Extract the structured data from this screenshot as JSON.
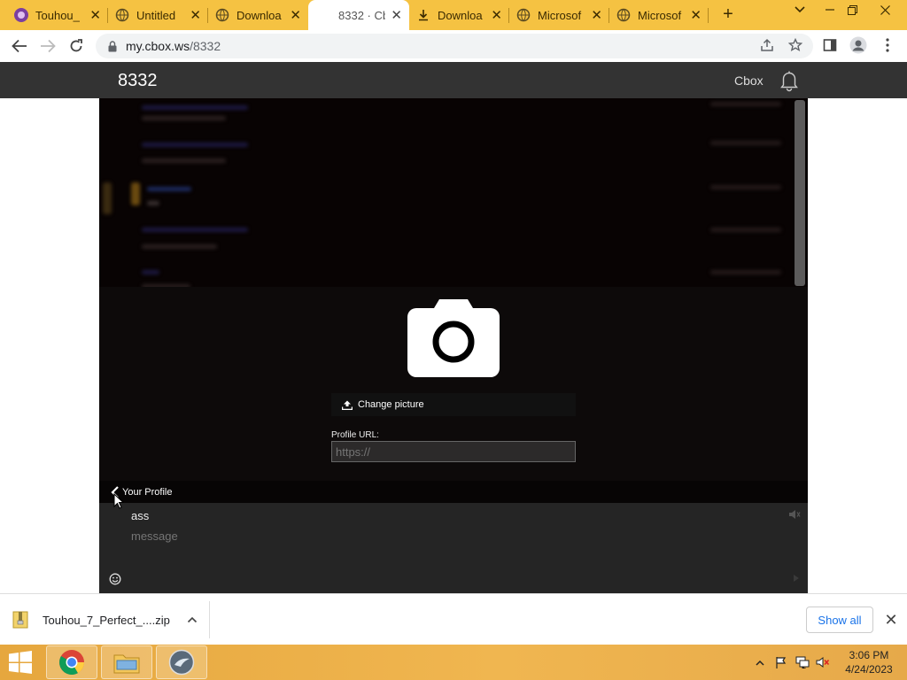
{
  "browser": {
    "tabs": [
      {
        "title": "Touhou_",
        "icon": "touhou-icon"
      },
      {
        "title": "Untitled",
        "icon": "globe-icon"
      },
      {
        "title": "Downloa",
        "icon": "globe-icon"
      },
      {
        "title": "8332 · Cb",
        "icon": "none"
      },
      {
        "title": "Downloa",
        "icon": "download-icon"
      },
      {
        "title": "Microsof",
        "icon": "globe-icon"
      },
      {
        "title": "Microsof",
        "icon": "globe-icon"
      }
    ],
    "url_host": "my.cbox.ws",
    "url_path": "/8332",
    "colors": {
      "tabstrip": "#f5c242",
      "accent": "#1a73e8"
    }
  },
  "cbox": {
    "room_name": "8332",
    "brand": "Cbox",
    "profile": {
      "change_picture_label": "Change picture",
      "profile_url_label": "Profile URL:",
      "profile_url_placeholder": "https://",
      "back_label": "Your Profile"
    },
    "compose": {
      "name": "ass",
      "message_placeholder": "message"
    }
  },
  "downloads": {
    "file_name": "Touhou_7_Perfect_....zip",
    "show_all_label": "Show all"
  },
  "taskbar": {
    "time": "3:06 PM",
    "date": "4/24/2023"
  }
}
